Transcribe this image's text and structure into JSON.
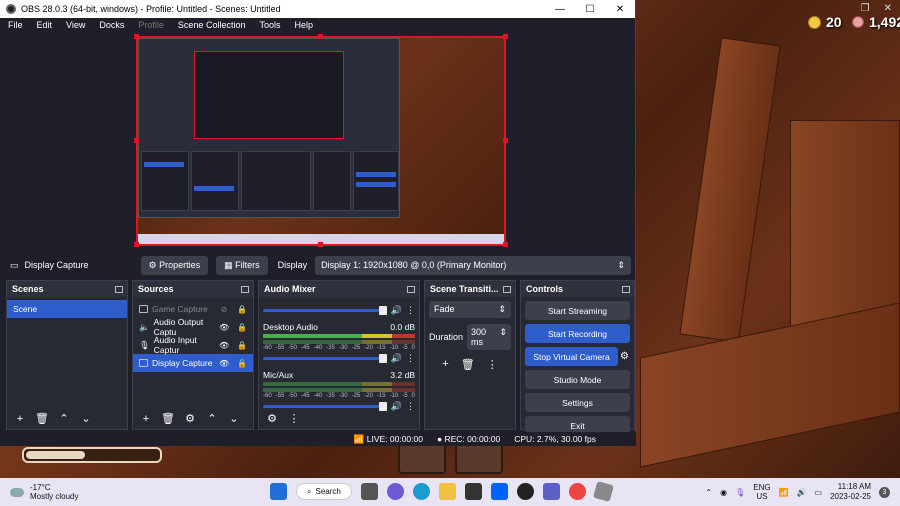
{
  "game": {
    "coins": "20",
    "gems": "1,492",
    "progress": 0.45
  },
  "window": {
    "title": "OBS 28.0.3 (64-bit, windows) - Profile: Untitled - Scenes: Untitled",
    "minimize": "—",
    "maximize": "☐",
    "close": "✕"
  },
  "menu": [
    "File",
    "Edit",
    "View",
    "Docks",
    "Profile",
    "Scene Collection",
    "Tools",
    "Help"
  ],
  "source_bar": {
    "source_name": "Display Capture",
    "properties": "Properties",
    "filters": "Filters",
    "display_label": "Display",
    "display_value": "Display 1: 1920x1080 @ 0,0 (Primary Monitor)"
  },
  "scenes": {
    "title": "Scenes",
    "items": [
      "Scene"
    ]
  },
  "sources": {
    "title": "Sources",
    "items": [
      {
        "label": "Game Capture"
      },
      {
        "label": "Audio Output Captu"
      },
      {
        "label": "Audio Input Captur"
      },
      {
        "label": "Display Capture"
      }
    ]
  },
  "mixer": {
    "title": "Audio Mixer",
    "channels": [
      {
        "name": "Desktop Audio",
        "level": "0.0 dB"
      },
      {
        "name": "Mic/Aux",
        "level": "3.2 dB"
      }
    ],
    "scale": [
      "-60",
      "-55",
      "-50",
      "-45",
      "-40",
      "-35",
      "-30",
      "-25",
      "-20",
      "-15",
      "-10",
      "-5",
      "0"
    ]
  },
  "transitions": {
    "title": "Scene Transiti...",
    "type": "Fade",
    "duration_label": "Duration",
    "duration_value": "300 ms"
  },
  "controls": {
    "title": "Controls",
    "start_streaming": "Start Streaming",
    "start_recording": "Start Recording",
    "stop_virtual_camera": "Stop Virtual Camera",
    "studio_mode": "Studio Mode",
    "settings": "Settings",
    "exit": "Exit"
  },
  "status": {
    "live": "LIVE: 00:00:00",
    "rec": "REC: 00:00:00",
    "cpu": "CPU: 2.7%, 30.00 fps"
  },
  "taskbar": {
    "temp": "-17°C",
    "weather": "Mostly cloudy",
    "search": "Search",
    "lang1": "ENG",
    "lang2": "US",
    "time": "11:18 AM",
    "date": "2023-02-25",
    "notifications": "3"
  }
}
